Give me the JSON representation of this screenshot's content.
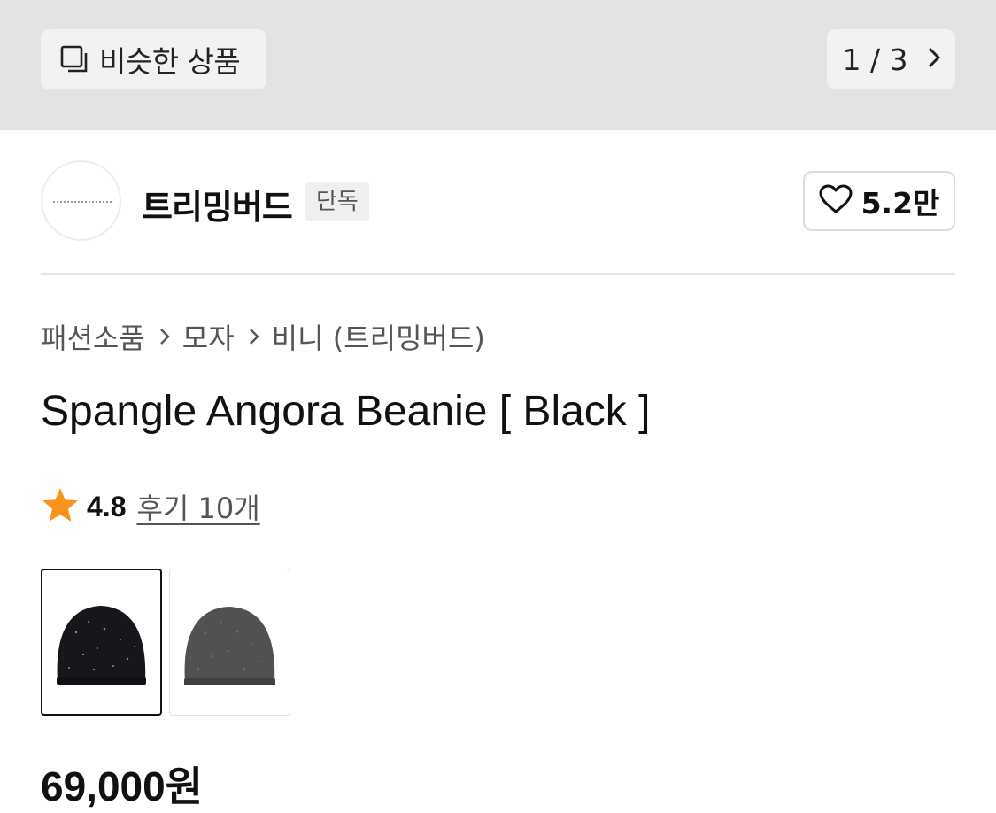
{
  "topbar": {
    "similar_label": "비슷한 상품",
    "similar_icon": "stacked-squares-icon",
    "pager_text": "1 / 3",
    "pager_icon": "chevron-right-icon"
  },
  "brand": {
    "name": "트리밍버드",
    "badge": "단독",
    "like_count": "5.2만",
    "like_icon": "heart-outline-icon"
  },
  "breadcrumb": {
    "items": [
      "패션소품",
      "모자",
      "비니 (트리밍버드)"
    ]
  },
  "product": {
    "title": "Spangle Angora Beanie [ Black ]",
    "rating": "4.8",
    "rating_icon": "star-icon",
    "rating_color": "#F7941D",
    "reviews_label": "후기 10개",
    "price": "69,000원"
  },
  "swatches": [
    {
      "color_name": "black",
      "hat_color": "#15171b",
      "selected": true
    },
    {
      "color_name": "charcoal",
      "hat_color": "#4f5250",
      "selected": false
    }
  ]
}
